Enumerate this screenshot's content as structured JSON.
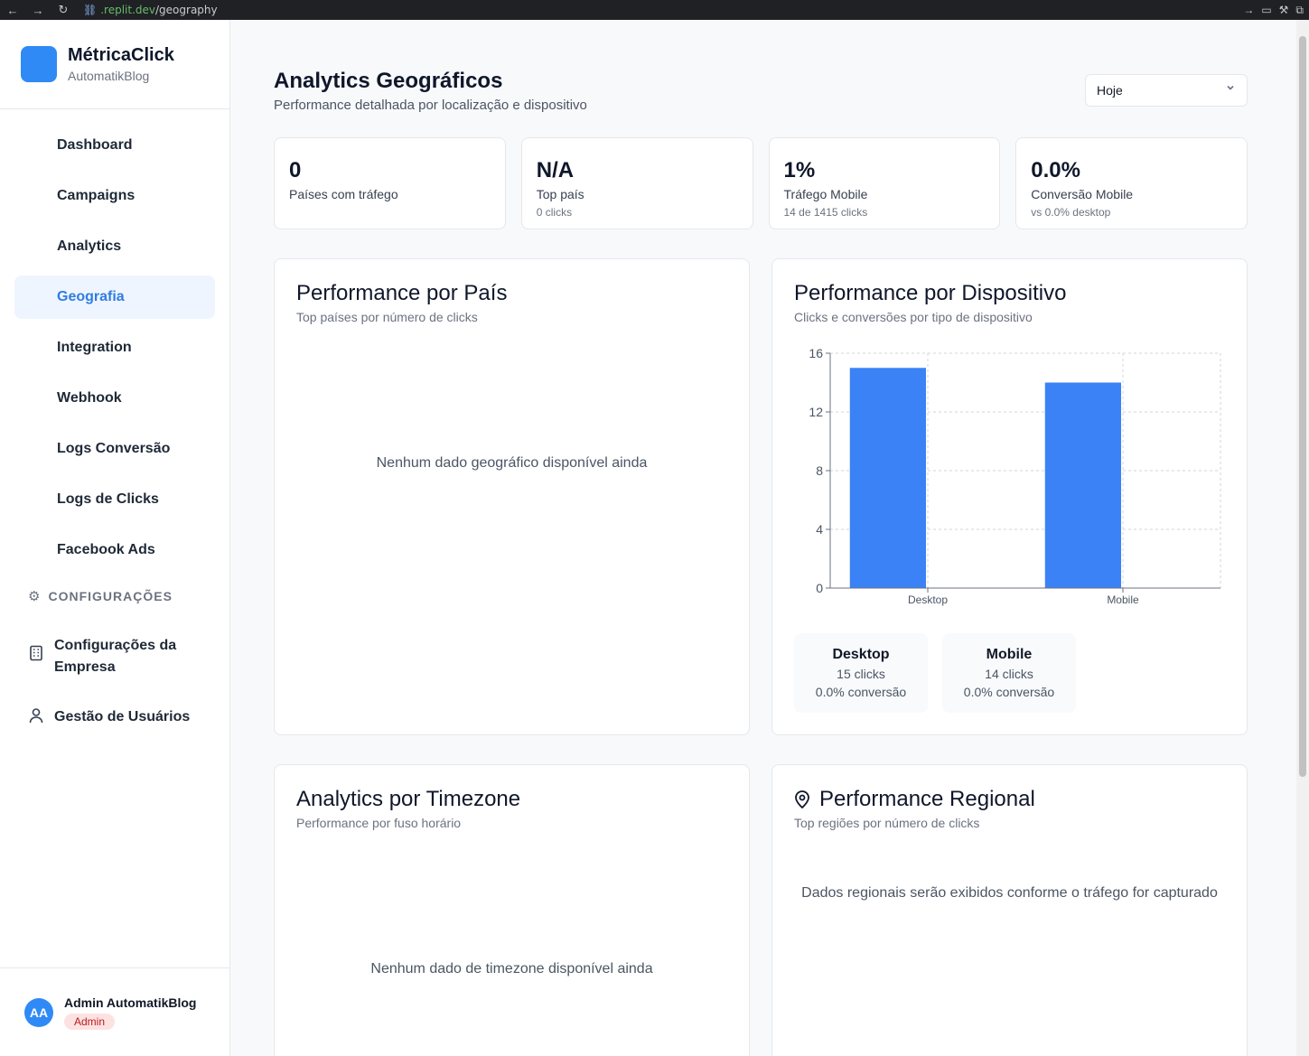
{
  "browser": {
    "url_prefix": ".replit.dev",
    "url_path": "/geography"
  },
  "sidebar": {
    "brand_name": "MétricaClick",
    "brand_sub": "AutomatikBlog",
    "items": [
      {
        "label": "Dashboard"
      },
      {
        "label": "Campaigns"
      },
      {
        "label": "Analytics"
      },
      {
        "label": "Geografia"
      },
      {
        "label": "Integration"
      },
      {
        "label": "Webhook"
      },
      {
        "label": "Logs Conversão"
      },
      {
        "label": "Logs de Clicks"
      },
      {
        "label": "Facebook Ads"
      }
    ],
    "active_index": 3,
    "section_title": "CONFIGURAÇÕES",
    "settings_items": [
      {
        "label": "Configurações da Empresa",
        "icon": "building-icon"
      },
      {
        "label": "Gestão de Usuários",
        "icon": "user-icon"
      }
    ],
    "user": {
      "initials": "AA",
      "name": "Admin AutomatikBlog",
      "role": "Admin"
    }
  },
  "header": {
    "title": "Analytics Geográficos",
    "subtitle": "Performance detalhada por localização e dispositivo",
    "period_select": "Hoje"
  },
  "stats": [
    {
      "value": "0",
      "label": "Países com tráfego",
      "sub": ""
    },
    {
      "value": "N/A",
      "label": "Top país",
      "sub": "0 clicks"
    },
    {
      "value": "1%",
      "label": "Tráfego Mobile",
      "sub": "14 de 1415 clicks"
    },
    {
      "value": "0.0%",
      "label": "Conversão Mobile",
      "sub": "vs 0.0% desktop"
    }
  ],
  "cards": {
    "country": {
      "title": "Performance por País",
      "subtitle": "Top países por número de clicks",
      "empty": "Nenhum dado geográfico disponível ainda"
    },
    "device": {
      "title": "Performance por Dispositivo",
      "subtitle": "Clicks e conversões por tipo de dispositivo",
      "devices": [
        {
          "name": "Desktop",
          "clicks": "15 clicks",
          "conversion": "0.0% conversão"
        },
        {
          "name": "Mobile",
          "clicks": "14 clicks",
          "conversion": "0.0% conversão"
        }
      ]
    },
    "timezone": {
      "title": "Analytics por Timezone",
      "subtitle": "Performance por fuso horário",
      "empty": "Nenhum dado de timezone disponível ainda"
    },
    "regional": {
      "title": "Performance Regional",
      "subtitle": "Top regiões por número de clicks",
      "empty": "Dados regionais serão exibidos conforme o tráfego for capturado"
    }
  },
  "chart_data": {
    "type": "bar",
    "categories": [
      "Desktop",
      "Mobile"
    ],
    "values": [
      15,
      14
    ],
    "yticks": [
      0,
      4,
      8,
      12,
      16
    ],
    "ylim": [
      0,
      16
    ],
    "grid": true,
    "color": "#3b82f6"
  }
}
